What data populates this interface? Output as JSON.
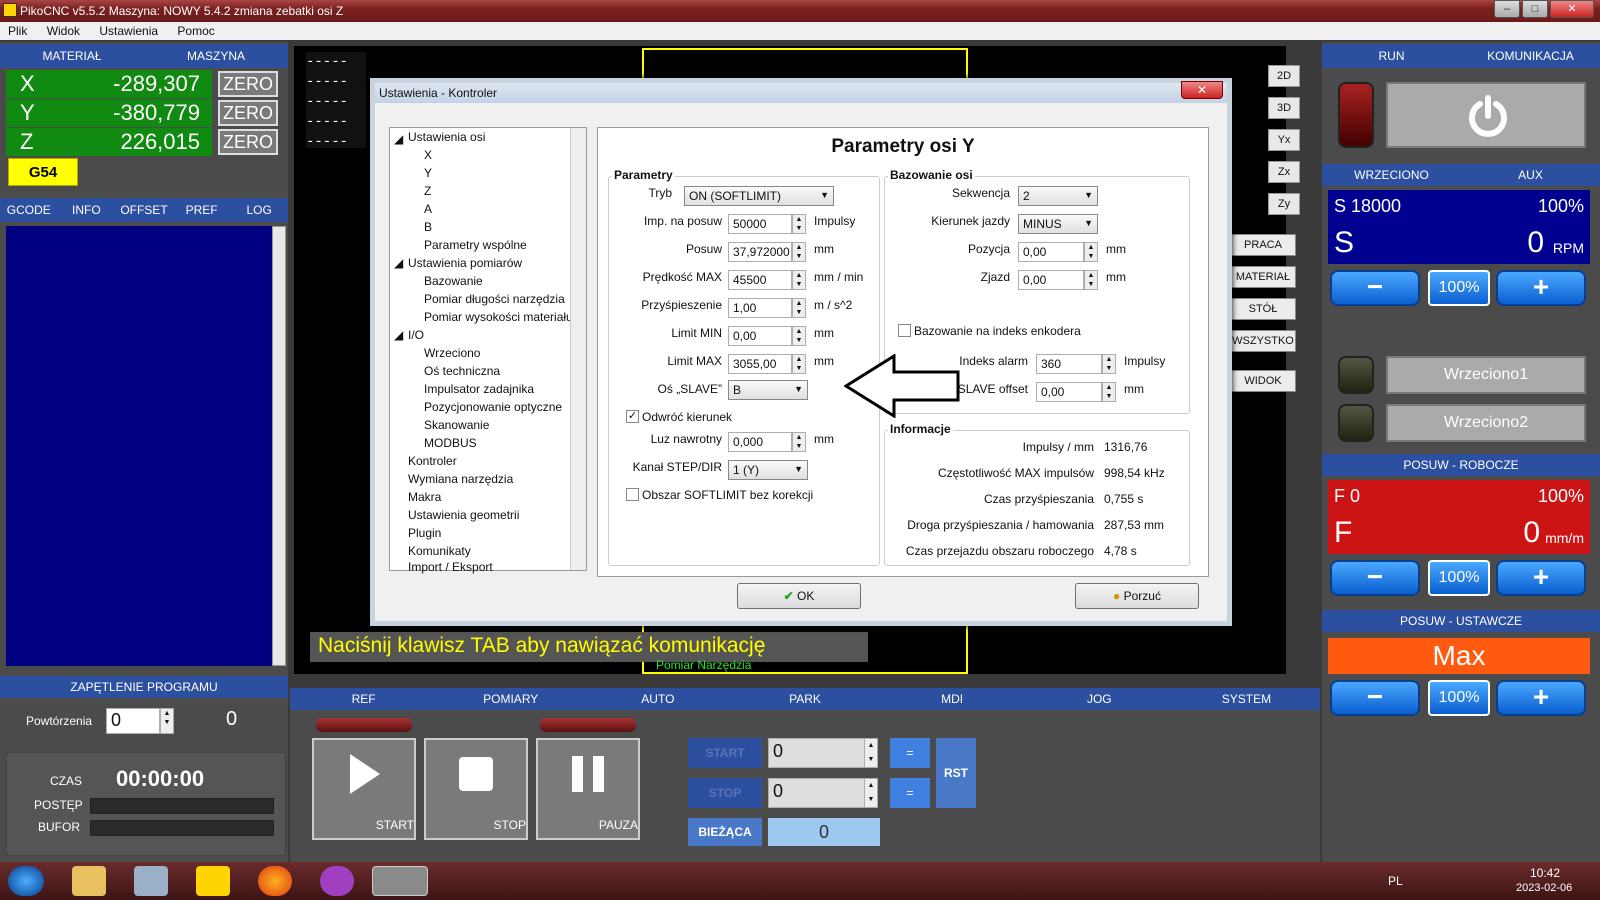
{
  "window": {
    "title": "PikoCNC v5.5.2   Maszyna: NOWY 5.4.2  zmiana zebatki osi Z"
  },
  "menu": [
    "Plik",
    "Widok",
    "Ustawienia",
    "Pomoc"
  ],
  "left": {
    "tabs_top": [
      "MATERIAŁ",
      "MASZYNA"
    ],
    "axes": [
      {
        "name": "X",
        "value": "-289,307"
      },
      {
        "name": "Y",
        "value": "-380,779"
      },
      {
        "name": "Z",
        "value": "226,015"
      }
    ],
    "zero_label": "ZERO",
    "wcs": "G54",
    "tabs": [
      "GCODE",
      "INFO",
      "OFFSET",
      "PREF",
      "LOG"
    ],
    "loop": {
      "header": "ZAPĘTLENIE PROGRAMU",
      "label": "Powtórzenia",
      "value": "0",
      "count": "0"
    },
    "time": {
      "label": "CZAS",
      "value": "00:00:00",
      "progress_label": "POSTĘP",
      "buffer_label": "BUFOR"
    }
  },
  "view": {
    "buttons": [
      "2D",
      "3D",
      "Yx",
      "Zx",
      "Zy"
    ],
    "side_buttons": [
      "PRACA",
      "MATERIAŁ",
      "STÓŁ",
      "WSZYSTKO",
      "WIDOK"
    ],
    "message": "Naciśnij klawisz TAB aby nawiązać komunikację",
    "overlay": "Pomiar Narzędzia",
    "dashes": [
      "-----",
      "-----",
      "-----",
      "-----",
      "-----"
    ]
  },
  "bottom": {
    "tabs": [
      "REF",
      "POMIARY",
      "AUTO",
      "PARK",
      "MDI",
      "JOG",
      "SYSTEM"
    ],
    "start": "START",
    "stop": "STOP",
    "pause": "PAUZA",
    "range": {
      "start_label": "START",
      "stop_label": "STOP",
      "start_value": "0",
      "stop_value": "0",
      "eq": "=",
      "rst": "RST",
      "current_label": "BIEŻĄCA",
      "current_value": "0"
    }
  },
  "right": {
    "run_tabs": [
      "RUN",
      "KOMUNIKACJA"
    ],
    "spindle_tabs": [
      "WRZECIONO",
      "AUX"
    ],
    "spindle": {
      "s_set": "S 18000",
      "s_pct": "100%",
      "s_label": "S",
      "s_value": "0",
      "s_unit": "RPM"
    },
    "pct": "100%",
    "minus": "−",
    "plus": "+",
    "outputs": [
      "Wrzeciono1",
      "Wrzeciono2"
    ],
    "feed_header": "POSUW - ROBOCZE",
    "feed": {
      "f_set": "F 0",
      "f_pct": "100%",
      "f_label": "F",
      "f_value": "0",
      "f_unit": "mm/m"
    },
    "rapid_header": "POSUW - USTAWCZE",
    "rapid": "Max"
  },
  "dialog": {
    "title": "Ustawienia - Kontroler",
    "close": "✕",
    "heading": "Parametry osi Y",
    "tree": [
      "Ustawienia osi",
      "X",
      "Y",
      "Z",
      "A",
      "B",
      "Parametry wspólne",
      "Ustawienia pomiarów",
      "Bazowanie",
      "Pomiar długości narzędzia",
      "Pomiar wysokości materiału",
      "I/O",
      "Wrzeciono",
      "Oś techniczna",
      "Impulsator zadajnika",
      "Pozycjonowanie optyczne",
      "Skanowanie",
      "MODBUS",
      "Kontroler",
      "Wymiana narzędzia",
      "Makra",
      "Ustawienia geometrii",
      "Plugin",
      "Komunikaty",
      "Import / Eksport"
    ],
    "params": {
      "group": "Parametry",
      "mode_label": "Tryb",
      "mode": "ON (SOFTLIMIT)",
      "imp_label": "Imp. na posuw",
      "imp": "50000",
      "imp_unit": "Impulsy",
      "feed_label": "Posuw",
      "feed": "37,972000",
      "feed_unit": "mm",
      "vmax_label": "Prędkość MAX",
      "vmax": "45500",
      "vmax_unit": "mm / min",
      "acc_label": "Przyśpieszenie",
      "acc": "1,00",
      "acc_unit": "m / s^2",
      "lmin_label": "Limit MIN",
      "lmin": "0,00",
      "lmin_unit": "mm",
      "lmax_label": "Limit MAX",
      "lmax": "3055,00",
      "lmax_unit": "mm",
      "slave_label": "Oś „SLAVE”",
      "slave": "B",
      "reverse_label": "Odwróć kierunek",
      "backlash_label": "Luz nawrotny",
      "backlash": "0,000",
      "backlash_unit": "mm",
      "channel_label": "Kanał STEP/DIR",
      "channel": "1 (Y)",
      "softlimit_label": "Obszar SOFTLIMIT bez korekcji"
    },
    "homing": {
      "group": "Bazowanie osi",
      "seq_label": "Sekwencja",
      "seq": "2",
      "dir_label": "Kierunek jazdy",
      "dir": "MINUS",
      "pos_label": "Pozycja",
      "pos": "0,00",
      "pos_unit": "mm",
      "retract_label": "Zjazd",
      "retract": "0,00",
      "retract_unit": "mm",
      "index_label": "Bazowanie na indeks enkodera",
      "alarm_label": "Indeks alarm",
      "alarm": "360",
      "alarm_unit": "Impulsy",
      "slave_off_label": "SLAVE offset",
      "slave_off": "0,00",
      "slave_off_unit": "mm"
    },
    "info": {
      "group": "Informacje",
      "rows": [
        {
          "label": "Impulsy / mm",
          "value": "1316,76"
        },
        {
          "label": "Częstotliwość MAX impulsów",
          "value": "998,54 kHz"
        },
        {
          "label": "Czas przyśpieszania",
          "value": "0,755 s"
        },
        {
          "label": "Droga przyśpieszania / hamowania",
          "value": "287,53 mm"
        },
        {
          "label": "Czas przejazdu obszaru roboczego",
          "value": "4,78 s"
        }
      ]
    },
    "ok": "OK",
    "cancel": "Porzuć"
  },
  "taskbar": {
    "lang": "PL",
    "time": "10:42",
    "date": "2023-02-06"
  }
}
